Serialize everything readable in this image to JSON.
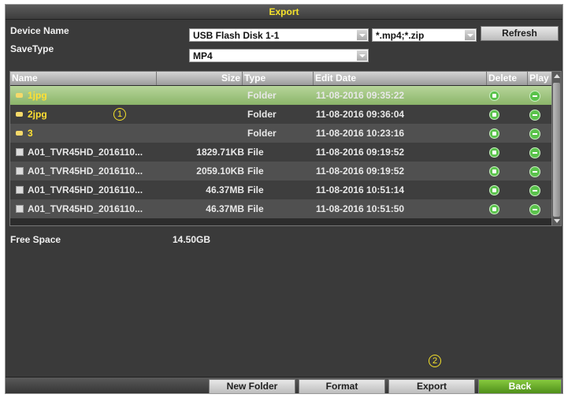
{
  "window": {
    "title": "Export"
  },
  "form": {
    "device_name_label": "Device Name",
    "device_name_value": "USB Flash Disk 1-1",
    "filter_value": "*.mp4;*.zip",
    "refresh_label": "Refresh",
    "savetype_label": "SaveType",
    "savetype_value": "MP4"
  },
  "table": {
    "columns": [
      "Name",
      "Size",
      "Type",
      "Edit Date",
      "Delete",
      "Play"
    ],
    "rows": [
      {
        "icon": "folder-icon",
        "name": "1jpg",
        "size": "",
        "type": "Folder",
        "date": "11-08-2016 09:35:22",
        "selected": true
      },
      {
        "icon": "folder-icon",
        "name": "2jpg",
        "size": "",
        "type": "Folder",
        "date": "11-08-2016 09:36:04",
        "selected": false
      },
      {
        "icon": "folder-icon",
        "name": "3",
        "size": "",
        "type": "Folder",
        "date": "11-08-2016 10:23:16",
        "selected": false
      },
      {
        "icon": "file-icon",
        "name": "A01_TVR45HD_2016110...",
        "size": "1829.71KB",
        "type": "File",
        "date": "11-08-2016 09:19:52",
        "selected": false
      },
      {
        "icon": "file-icon",
        "name": "A01_TVR45HD_2016110...",
        "size": "2059.10KB",
        "type": "File",
        "date": "11-08-2016 09:19:52",
        "selected": false
      },
      {
        "icon": "file-icon",
        "name": "A01_TVR45HD_2016110...",
        "size": "46.37MB",
        "type": "File",
        "date": "11-08-2016 10:51:14",
        "selected": false
      },
      {
        "icon": "file-icon",
        "name": "A01_TVR45HD_2016110...",
        "size": "46.37MB",
        "type": "File",
        "date": "11-08-2016 10:51:50",
        "selected": false
      }
    ]
  },
  "free_space": {
    "label": "Free Space",
    "value": "14.50GB"
  },
  "markers": {
    "one": "1",
    "two": "2"
  },
  "buttons": {
    "new_folder": "New Folder",
    "format": "Format",
    "export": "Export",
    "back": "Back"
  },
  "colors": {
    "title": "#f5e22a",
    "folder_text": "#ffe033",
    "selected_row": "#a8cc88",
    "back_button": "#5fa52a",
    "icon_green": "#5ac24b"
  }
}
